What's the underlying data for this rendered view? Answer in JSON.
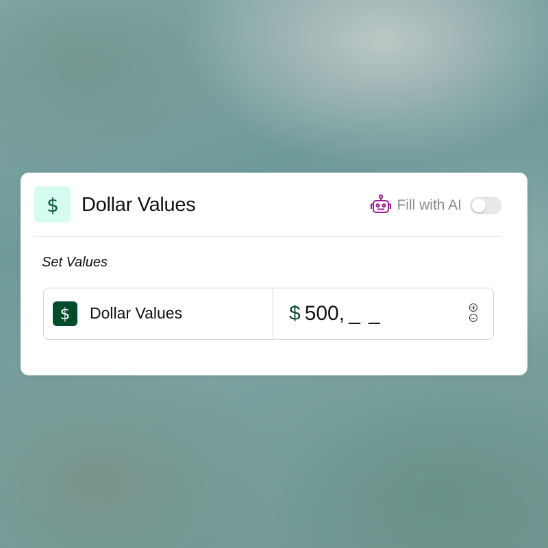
{
  "card": {
    "icon": "dollar-icon",
    "title": "Dollar Values",
    "fill_ai": {
      "icon": "robot-icon",
      "label": "Fill with AI",
      "enabled": false
    }
  },
  "section": {
    "label": "Set Values"
  },
  "field": {
    "icon": "dollar-icon",
    "label": "Dollar Values",
    "currency_symbol": "$",
    "value": "500,",
    "mask": "_ _",
    "stepper": {
      "increment_icon": "plus-circle-icon",
      "decrement_icon": "minus-circle-icon"
    }
  },
  "colors": {
    "accent_light": "#d6fbf0",
    "accent_dark": "#004d2e",
    "robot": "#a3189a"
  }
}
